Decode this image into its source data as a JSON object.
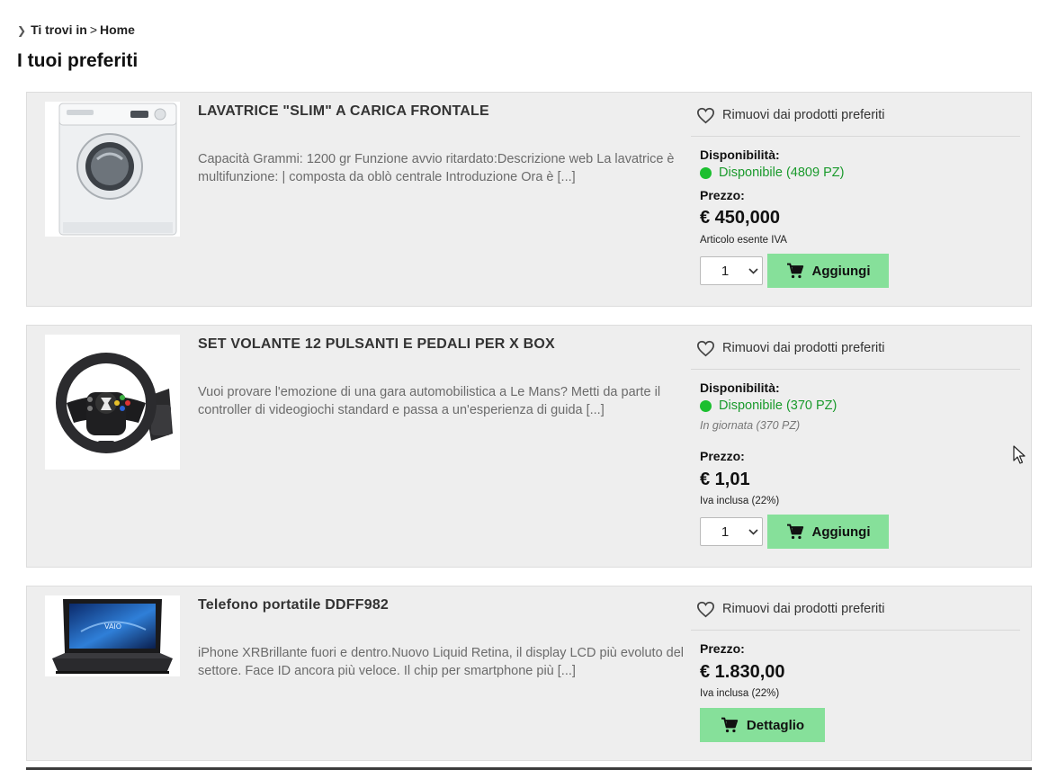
{
  "breadcrumb": {
    "label": "Ti trovi in",
    "separator": ">",
    "current": "Home"
  },
  "page": {
    "title": "I tuoi preferiti"
  },
  "colors": {
    "card_bg": "#eeeeee",
    "button_green": "#86e09a",
    "available_green": "#1a9a2c"
  },
  "products": [
    {
      "name": "LAVATRICE \"SLIM\" A CARICA FRONTALE",
      "description": "Capacità Grammi: 1200 gr Funzione avvio ritardato:Descrizione web La lavatrice è multifunzione: | composta da oblò centrale Introduzione Ora è [...]",
      "remove_label": "Rimuovi dai prodotti preferiti",
      "availability_label": "Disponibilità:",
      "availability": "Disponibile (4809 PZ)",
      "price_label": "Prezzo:",
      "price": "€ 450,000",
      "tax_note": "Articolo esente IVA",
      "quantity": "1",
      "button_label": "Aggiungi",
      "image_icon": "washing-machine"
    },
    {
      "name": "SET VOLANTE 12 PULSANTI E PEDALI PER X BOX",
      "description": "Vuoi provare l'emozione di una gara automobilistica a Le Mans? Metti da parte il controller di videogiochi standard e passa a un'esperienza di guida [...]",
      "remove_label": "Rimuovi dai prodotti preferiti",
      "availability_label": "Disponibilità:",
      "availability": "Disponibile (370 PZ)",
      "availability_today": "In giornata (370 PZ)",
      "price_label": "Prezzo:",
      "price": "€ 1,01",
      "tax_note": "Iva inclusa (22%)",
      "quantity": "1",
      "button_label": "Aggiungi",
      "image_icon": "steering-wheel"
    },
    {
      "name": "Telefono portatile DDFF982",
      "description": "iPhone XRBrillante fuori e dentro.Nuovo Liquid Retina, il display LCD più evoluto del settore. Face ID ancora più veloce. Il chip per smartphone più [...]",
      "remove_label": "Rimuovi dai prodotti preferiti",
      "price_label": "Prezzo:",
      "price": "€ 1.830,00",
      "tax_note": "Iva inclusa (22%)",
      "button_label": "Dettaglio",
      "image_icon": "laptop"
    }
  ]
}
